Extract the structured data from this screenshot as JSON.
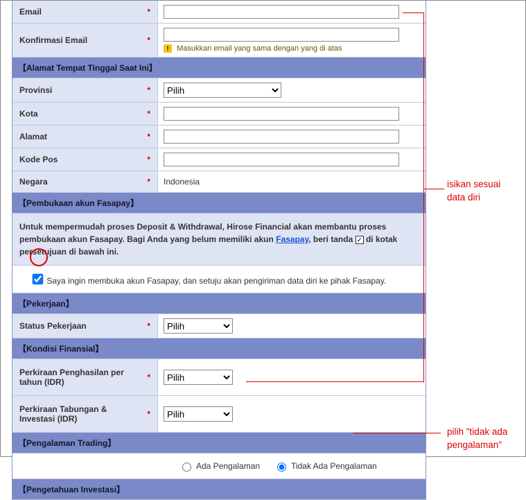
{
  "labels": {
    "email": "Email",
    "confirm_email": "Konfirmasi Email",
    "provinsi": "Provinsi",
    "kota": "Kota",
    "alamat": "Alamat",
    "kodepos": "Kode Pos",
    "negara": "Negara",
    "status_pekerjaan": "Status Pekerjaan",
    "penghasilan": "Perkiraan Penghasilan per tahun (IDR)",
    "tabungan": "Perkiraan Tabungan & Investasi (IDR)"
  },
  "required_mark": "*",
  "hints": {
    "confirm_email": "Masukkan email yang sama dengan yang di atas"
  },
  "sections": {
    "alamat": "【Alamat Tempat Tinggal Saat Ini】",
    "fasapay": "【Pembukaan akun Fasapay】",
    "pekerjaan": "【Pekerjaan】",
    "finansial": "【Kondisi Finansial】",
    "trading": "【Pengalaman Trading】",
    "investasi": "【Pengetahuan Investasi】"
  },
  "static": {
    "negara_value": "Indonesia"
  },
  "selects": {
    "pilih": "Pilih"
  },
  "fasapay": {
    "instr_pre": "Untuk mempermudah proses Deposit & Withdrawal, Hirose Financial akan membantu proses pembukaan akun Fasapay. Bagi Anda yang belum memiliki akun ",
    "link": "Fasapay",
    "instr_mid": ", beri tanda ",
    "instr_post": " di kotak persetujuan di bawah ini.",
    "agree": "Saya ingin membuka akun Fasapay, dan setuju akan pengiriman data diri ke pihak Fasapay."
  },
  "trading": {
    "ada": "Ada Pengalaman",
    "tidak": "Tidak Ada Pengalaman"
  },
  "annotations": {
    "data_diri": "isikan sesuai\ndata diri",
    "tidak_ada": "pilih \"tidak ada\npengalaman\""
  }
}
